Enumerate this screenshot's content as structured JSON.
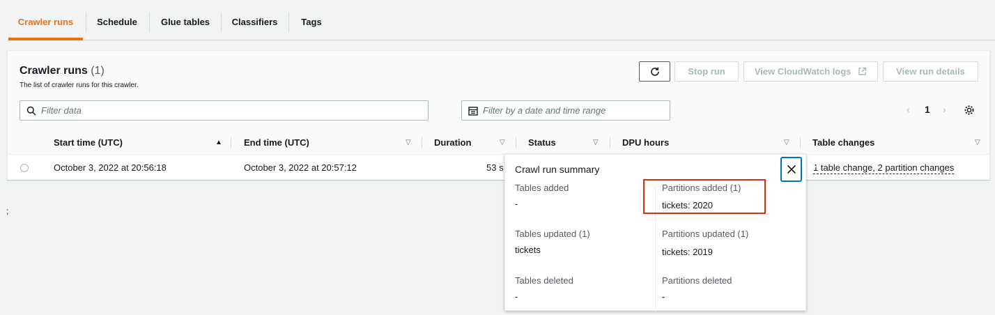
{
  "tabs": [
    {
      "label": "Crawler runs",
      "active": true
    },
    {
      "label": "Schedule"
    },
    {
      "label": "Glue tables"
    },
    {
      "label": "Classifiers"
    },
    {
      "label": "Tags"
    }
  ],
  "panel": {
    "title": "Crawler runs",
    "count": "(1)",
    "description": "The list of crawler runs for this crawler."
  },
  "buttons": {
    "refresh_icon": "refresh-icon",
    "stop_run": "Stop run",
    "view_logs": "View CloudWatch logs",
    "view_details": "View run details"
  },
  "filters": {
    "data_placeholder": "Filter data",
    "date_placeholder": "Filter by a date and time range"
  },
  "pagination": {
    "page": "1"
  },
  "table": {
    "columns": [
      "Start time (UTC)",
      "End time (UTC)",
      "Duration",
      "Status",
      "DPU hours",
      "Table changes"
    ],
    "row": {
      "start": "October 3, 2022 at 20:56:18",
      "end": "October 3, 2022 at 20:57:12",
      "duration": "53 s",
      "changes": "1 table change, 2 partition changes"
    }
  },
  "stray_text": ";",
  "summary": {
    "title": "Crawl run summary",
    "tables_added_label": "Tables added",
    "tables_added_value": "-",
    "partitions_added_label": "Partitions added (1)",
    "partitions_added_value": "tickets: 2020",
    "tables_updated_label": "Tables updated (1)",
    "tables_updated_value": "tickets",
    "partitions_updated_label": "Partitions updated (1)",
    "partitions_updated_value": "tickets: 2019",
    "tables_deleted_label": "Tables deleted",
    "tables_deleted_value": "-",
    "partitions_deleted_label": "Partitions deleted",
    "partitions_deleted_value": "-"
  },
  "colors": {
    "accent": "#ec7211",
    "focus": "#0073bb",
    "highlight": "#d13212"
  }
}
